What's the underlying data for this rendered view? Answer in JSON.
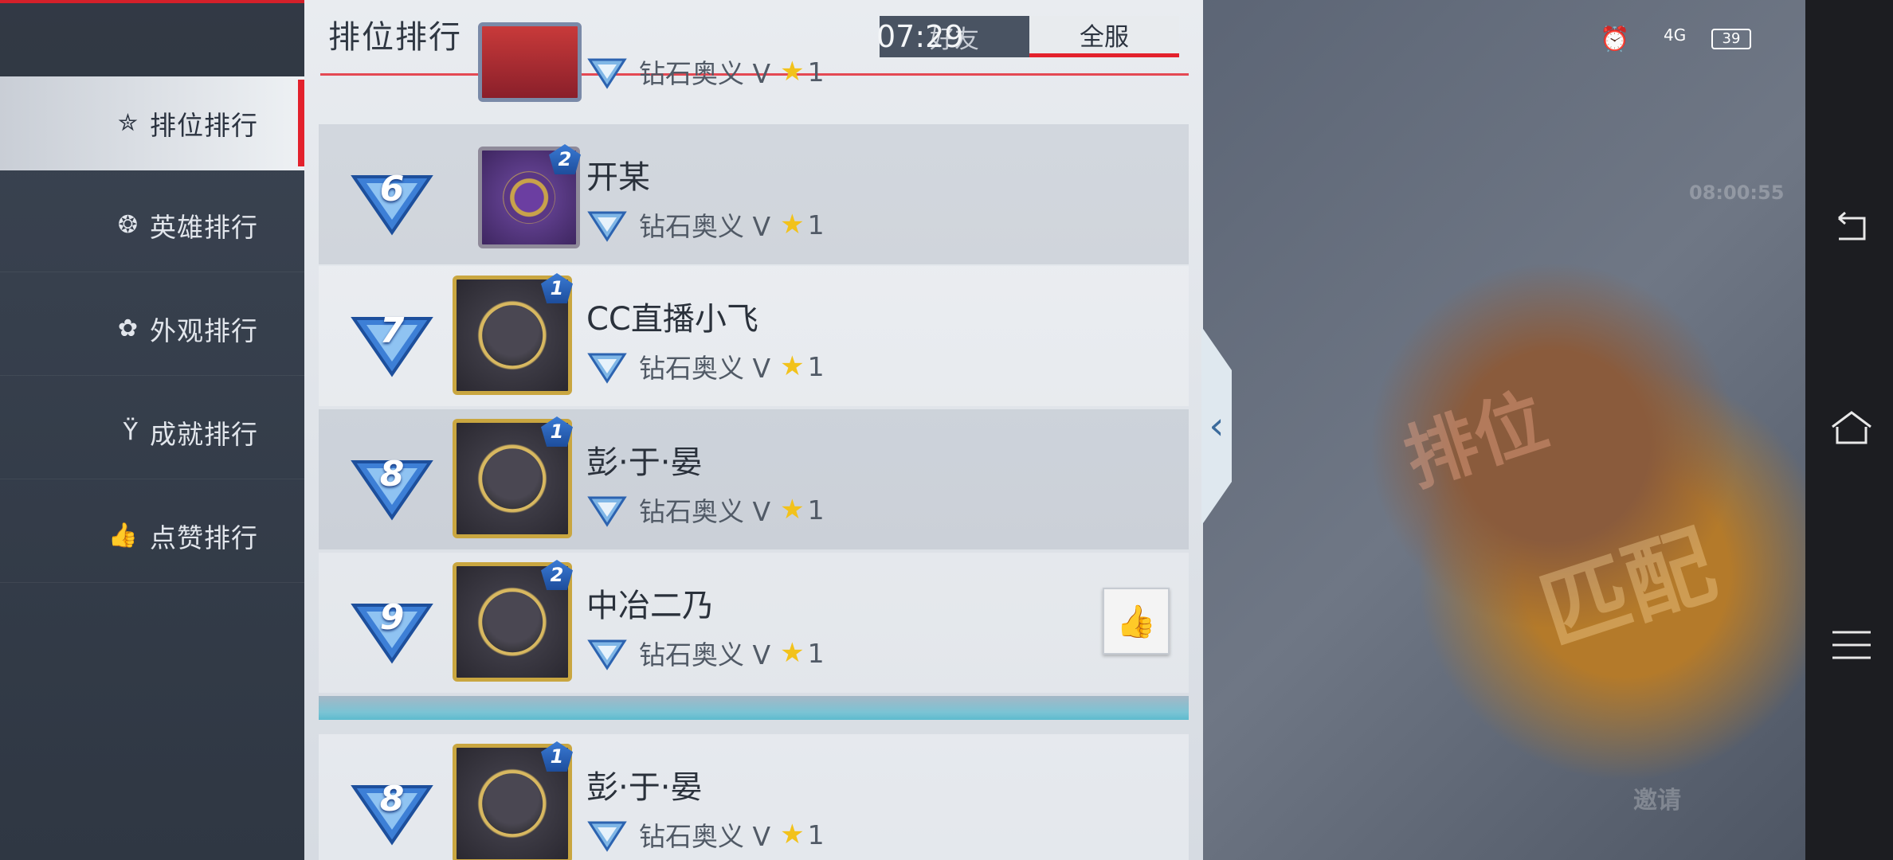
{
  "status": {
    "time": "07:29",
    "battery": "39",
    "signal": "4G"
  },
  "sidebar": {
    "items": [
      {
        "label": "排位排行",
        "icon": "star-icon",
        "active": true
      },
      {
        "label": "英雄排行",
        "icon": "hero-icon"
      },
      {
        "label": "外观排行",
        "icon": "shirt-icon"
      },
      {
        "label": "成就排行",
        "icon": "trophy-icon"
      },
      {
        "label": "点赞排行",
        "icon": "thumb-icon"
      }
    ]
  },
  "panel": {
    "title": "排位排行",
    "tabs": {
      "friends": "好友",
      "server": "全服"
    }
  },
  "rows": [
    {
      "rank": "",
      "name": "",
      "tier": "钻石奥义 V",
      "stars": "1"
    },
    {
      "rank": "6",
      "name": "开某",
      "tier": "钻石奥义 V",
      "stars": "1",
      "avatar_level": "2"
    },
    {
      "rank": "7",
      "name": "CC直播小飞",
      "tier": "钻石奥义 V",
      "stars": "1",
      "avatar_level": "1"
    },
    {
      "rank": "8",
      "name": "彭·于·晏",
      "tier": "钻石奥义 V",
      "stars": "1",
      "avatar_level": "1"
    },
    {
      "rank": "9",
      "name": "中冶二乃",
      "tier": "钻石奥义 V",
      "stars": "1",
      "avatar_level": "2"
    },
    {
      "rank": "8",
      "name": "彭·于·晏",
      "tier": "钻石奥义 V",
      "stars": "1",
      "avatar_level": "1"
    }
  ],
  "background": {
    "match_label": "匹配",
    "rank_label": "排位",
    "invite_label": "邀请",
    "timer": "08:00:55"
  },
  "colors": {
    "accent": "#e3212c",
    "rank_blue": "#2f6fd0"
  }
}
